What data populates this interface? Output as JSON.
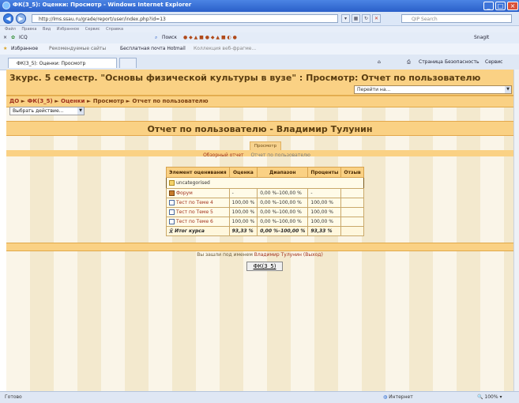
{
  "window": {
    "title": "ФК(3_5): Оценки: Просмотр - Windows Internet Explorer"
  },
  "address": {
    "url": "http://lms.ssau.ru/grade/report/user/index.php?id=13",
    "search_placeholder": "QIP Search"
  },
  "menu": {
    "items": [
      "Файл",
      "Правка",
      "Вид",
      "Избранное",
      "Сервис",
      "Справка"
    ]
  },
  "toolbar": {
    "icq": "ICQ",
    "search_label": "Поиск",
    "snagit": "SnagIt"
  },
  "favorites": {
    "label": "Избранное",
    "items": [
      "Рекомендуемые сайты",
      "Бесплатная почта Hotmail",
      "Коллекция веб-фрагме..."
    ]
  },
  "tab": {
    "label": "ФК(3_5): Оценки: Просмотр"
  },
  "ie_commands": {
    "page": "Страница",
    "safety": "Безопасность",
    "tools": "Сервис"
  },
  "page": {
    "title": "3курс. 5 семестр. \"Основы физической культуры в вузе\" : Просмотр: Отчет по пользователю",
    "jump_placeholder": "Перейти на..."
  },
  "breadcrumb": {
    "items": [
      "ДО",
      "ФК(3_5)",
      "Оценки",
      "Просмотр",
      "Отчет по пользователю"
    ]
  },
  "action_select": {
    "value": "Выбрать действие..."
  },
  "report": {
    "title": "Отчет по пользователю - Владимир Тулунин",
    "view_tab": "Просмотр",
    "subtabs": [
      "Обзорный отчет",
      "Отчет по пользователю"
    ],
    "columns": [
      "Элемент оценивания",
      "Оценка",
      "Диапазон",
      "Проценты",
      "Отзыв"
    ],
    "category": "uncategorised",
    "rows": [
      {
        "icon": "forum-icon",
        "name": "Форум",
        "grade": "-",
        "range": "0,00 %–100,00 %",
        "percent": "-",
        "feedback": ""
      },
      {
        "icon": "quiz-icon",
        "name": "Тест по Теме 4",
        "grade": "100,00 %",
        "range": "0,00 %–100,00 %",
        "percent": "100,00 %",
        "feedback": ""
      },
      {
        "icon": "quiz-icon",
        "name": "Тест по Теме 5",
        "grade": "100,00 %",
        "range": "0,00 %–100,00 %",
        "percent": "100,00 %",
        "feedback": ""
      },
      {
        "icon": "quiz-icon",
        "name": "Тест по Теме 6",
        "grade": "100,00 %",
        "range": "0,00 %–100,00 %",
        "percent": "100,00 %",
        "feedback": ""
      }
    ],
    "total": {
      "name": "Итог курса",
      "grade": "93,33 %",
      "range": "0,00 %–100,00 %",
      "percent": "93,33 %"
    }
  },
  "footer": {
    "login_prefix": "Вы зашли под именем",
    "user": "Владимир Тулунин",
    "logout": "(Выход)",
    "home_button": "ФК(3_5)"
  },
  "status": {
    "left": "Готово",
    "zone": "Интернет",
    "zoom": "100%"
  }
}
